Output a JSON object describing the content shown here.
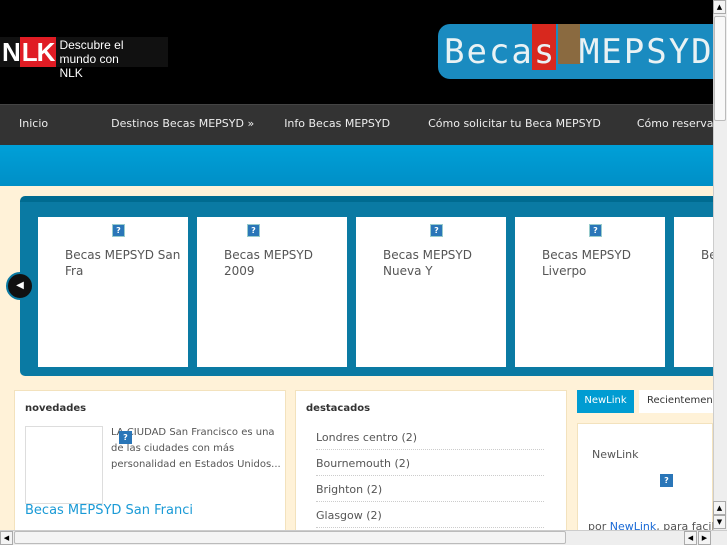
{
  "header": {
    "logo_text": "NLK",
    "logo_tagline": "Descubre el mundo con NLK",
    "banner_text": "Becas MEPSYD"
  },
  "nav": [
    "Inicio",
    "Destinos Becas MEPSYD »",
    "Info Becas MEPSYD",
    "Cómo solicitar tu Beca MEPSYD",
    "Cómo reservar un curso"
  ],
  "carousel": {
    "items": [
      "Becas MEPSYD San Fra",
      "Becas MEPSYD 2009",
      "Becas MEPSYD Nueva Y",
      "Becas MEPSYD Liverpo",
      "Becas MEPSYD Sl"
    ],
    "missing_image_glyph": "?",
    "prev_icon": "◀"
  },
  "novedades": {
    "heading": "novedades",
    "description": "LA CIUDAD San Francisco es una de las ciudades con más personalidad en Estados Unidos...",
    "title": "Becas MEPSYD San Franci"
  },
  "destacados": {
    "heading": "destacados",
    "items": [
      "Londres centro (2)",
      "Bournemouth (2)",
      "Brighton (2)",
      "Glasgow (2)"
    ]
  },
  "sidebar": {
    "tabs": [
      "NewLink",
      "Recientemente"
    ],
    "heading": "NewLink",
    "por": "por",
    "link": "NewLink",
    "rest": ", para facilitar"
  },
  "colors": {
    "accent": "#009cd2",
    "nav_bg": "#333333",
    "page_bg": "#fff2d8",
    "carousel_bg": "#0a7aa3"
  }
}
